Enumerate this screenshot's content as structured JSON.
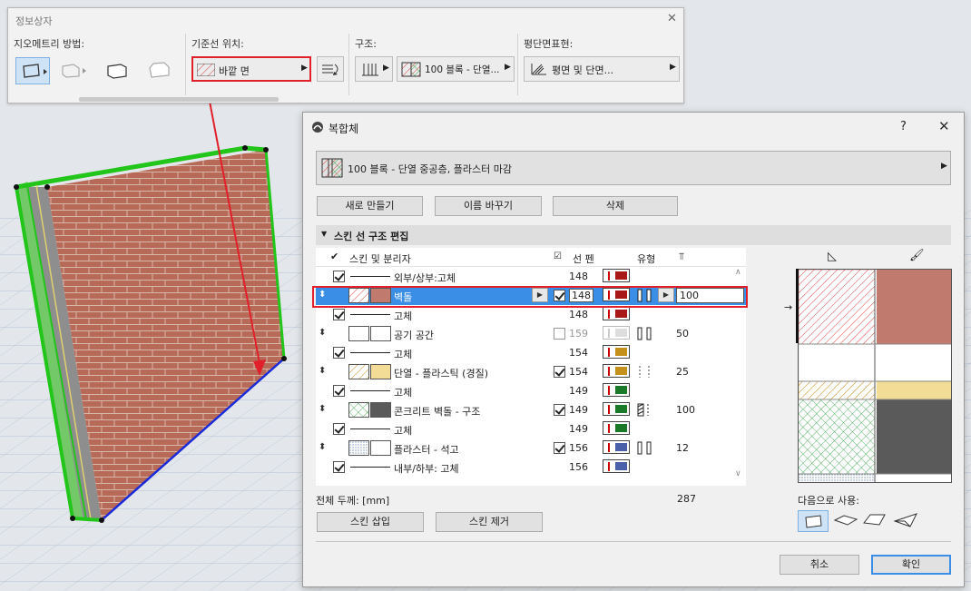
{
  "info_box": {
    "title": "정보상자",
    "geometry_label": "지오메트리 방법:",
    "reference_label": "기준선 위치:",
    "reference_value": "바깥 면",
    "structure_label": "구조:",
    "structure_value": "100 블록 - 단열...",
    "floorplan_label": "평단면표현:",
    "floorplan_value": "평면 및 단면..."
  },
  "dialog": {
    "title": "복합체",
    "help": "?",
    "composite_name": "100 블록 - 단열 중공층, 플라스터 마감",
    "btn_new": "새로 만들기",
    "btn_rename": "이름 바꾸기",
    "btn_delete": "삭제",
    "section_title": "스킨 선 구조 편집",
    "columns": {
      "skin": "스킨 및 분리자",
      "pen": "선 펜",
      "type": "유형"
    },
    "rows": [
      {
        "kind": "line",
        "label": "외부/상부:고체",
        "pen": "148"
      },
      {
        "kind": "skin",
        "label": "벽돌",
        "pen": "148",
        "thick": "100",
        "selected": true
      },
      {
        "kind": "line",
        "label": "고체",
        "pen": "148"
      },
      {
        "kind": "skin",
        "label": "공기 공간",
        "pen": "159",
        "thick": "50"
      },
      {
        "kind": "line",
        "label": "고체",
        "pen": "154"
      },
      {
        "kind": "skin",
        "label": "단열 - 플라스틱 (경질)",
        "pen": "154",
        "thick": "25"
      },
      {
        "kind": "line",
        "label": "고체",
        "pen": "149"
      },
      {
        "kind": "skin",
        "label": "콘크리트 벽돌 - 구조",
        "pen": "149",
        "thick": "100"
      },
      {
        "kind": "line",
        "label": "고체",
        "pen": "149"
      },
      {
        "kind": "skin",
        "label": "플라스터 - 석고",
        "pen": "156",
        "thick": "12"
      },
      {
        "kind": "line",
        "label": "내부/하부: 고체",
        "pen": "156"
      }
    ],
    "total_label": "전체 두께: [mm]",
    "total_value": "287",
    "btn_insert": "스킨 삽입",
    "btn_remove": "스킨 제거",
    "use_for_label": "다음으로 사용:",
    "btn_cancel": "취소",
    "btn_ok": "확인"
  },
  "colors": {
    "accent": "#e0202a",
    "selection": "#3a8ee6",
    "brick": "#c07a6e",
    "wall_edge": "#22c51a"
  }
}
